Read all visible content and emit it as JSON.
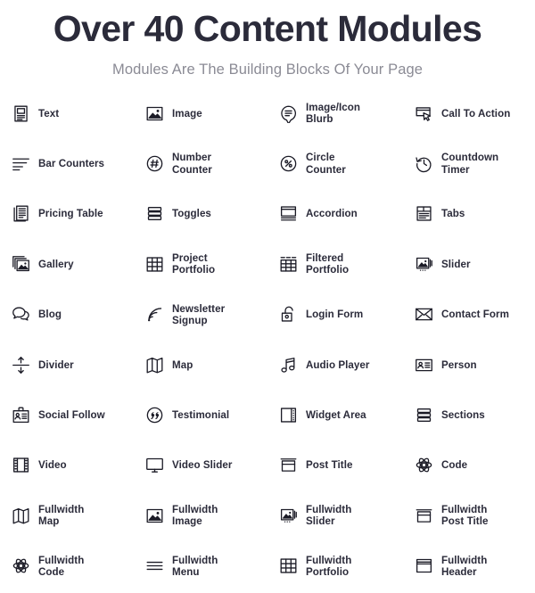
{
  "header": {
    "title": "Over 40 Content Modules",
    "subtitle": "Modules Are The Building Blocks Of Your Page"
  },
  "colors": {
    "title": "#2b2b3a",
    "subtitle": "#8b8b95",
    "label": "#2b2b3a",
    "icon": "#1b1b26",
    "background": "#ffffff"
  },
  "modules": [
    {
      "label": "Text",
      "icon": "document-text-icon"
    },
    {
      "label": "Image",
      "icon": "image-icon"
    },
    {
      "label": "Image/Icon\nBlurb",
      "icon": "speech-bubble-lines-icon"
    },
    {
      "label": "Call To Action",
      "icon": "cursor-button-icon"
    },
    {
      "label": "Bar Counters",
      "icon": "horizontal-bars-icon"
    },
    {
      "label": "Number\nCounter",
      "icon": "hash-circle-icon"
    },
    {
      "label": "Circle\nCounter",
      "icon": "percent-circle-icon"
    },
    {
      "label": "Countdown\nTimer",
      "icon": "clock-rewind-icon"
    },
    {
      "label": "Pricing Table",
      "icon": "pricing-table-icon"
    },
    {
      "label": "Toggles",
      "icon": "stacked-bars-icon"
    },
    {
      "label": "Accordion",
      "icon": "accordion-icon"
    },
    {
      "label": "Tabs",
      "icon": "tabs-icon"
    },
    {
      "label": "Gallery",
      "icon": "stacked-images-icon"
    },
    {
      "label": "Project\nPortfolio",
      "icon": "grid-icon"
    },
    {
      "label": "Filtered\nPortfolio",
      "icon": "grid-filter-icon"
    },
    {
      "label": "Slider",
      "icon": "slider-images-icon"
    },
    {
      "label": "Blog",
      "icon": "chat-bubbles-icon"
    },
    {
      "label": "Newsletter\nSignup",
      "icon": "rss-signal-icon"
    },
    {
      "label": "Login Form",
      "icon": "unlocked-padlock-icon"
    },
    {
      "label": "Contact Form",
      "icon": "envelope-icon"
    },
    {
      "label": "Divider",
      "icon": "vertical-arrows-divider-icon"
    },
    {
      "label": "Map",
      "icon": "folded-map-icon"
    },
    {
      "label": "Audio Player",
      "icon": "music-note-icon"
    },
    {
      "label": "Person",
      "icon": "id-card-icon"
    },
    {
      "label": "Social Follow",
      "icon": "badge-person-icon"
    },
    {
      "label": "Testimonial",
      "icon": "quote-circle-icon"
    },
    {
      "label": "Widget Area",
      "icon": "widget-panel-icon"
    },
    {
      "label": "Sections",
      "icon": "stacked-bars-icon"
    },
    {
      "label": "Video",
      "icon": "film-strip-icon"
    },
    {
      "label": "Video Slider",
      "icon": "monitor-icon"
    },
    {
      "label": "Post Title",
      "icon": "post-title-icon"
    },
    {
      "label": "Code",
      "icon": "atom-icon"
    },
    {
      "label": "Fullwidth\nMap",
      "icon": "folded-map-icon"
    },
    {
      "label": "Fullwidth\nImage",
      "icon": "image-icon"
    },
    {
      "label": "Fullwidth\nSlider",
      "icon": "slider-images-icon"
    },
    {
      "label": "Fullwidth\nPost Title",
      "icon": "post-title-icon"
    },
    {
      "label": "Fullwidth\nCode",
      "icon": "atom-icon"
    },
    {
      "label": "Fullwidth\nMenu",
      "icon": "hamburger-menu-icon"
    },
    {
      "label": "Fullwidth\nPortfolio",
      "icon": "grid-icon"
    },
    {
      "label": "Fullwidth\nHeader",
      "icon": "header-panel-icon"
    }
  ]
}
